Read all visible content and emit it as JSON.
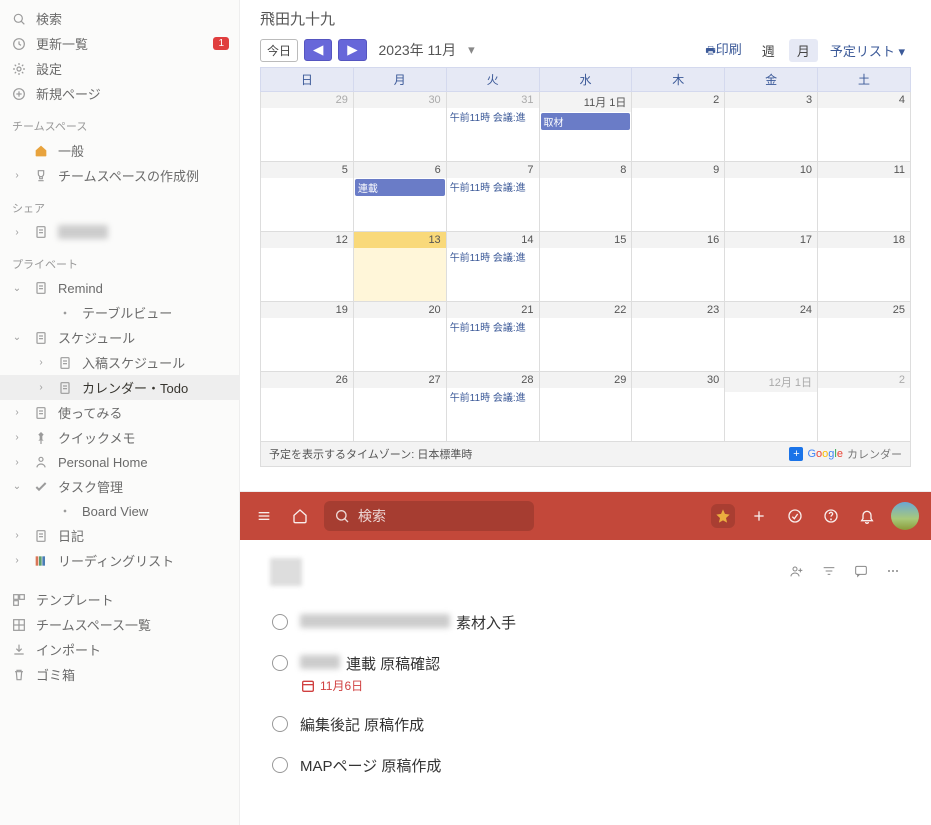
{
  "sidebar": {
    "top": [
      {
        "icon": "search",
        "label": "検索"
      },
      {
        "icon": "clock",
        "label": "更新一覧",
        "badge": "1"
      },
      {
        "icon": "gear",
        "label": "設定"
      },
      {
        "icon": "plus-circle",
        "label": "新規ページ"
      }
    ],
    "sections": [
      {
        "title": "チームスペース",
        "items": [
          {
            "chev": "",
            "icon": "home",
            "label": "一般",
            "color": "#e8a33d"
          },
          {
            "chev": "›",
            "icon": "trophy",
            "label": "チームスペースの作成例"
          }
        ]
      },
      {
        "title": "シェア",
        "items": [
          {
            "chev": "›",
            "icon": "page",
            "label": "",
            "blurred": true
          }
        ]
      },
      {
        "title": "プライベート",
        "items": [
          {
            "chev": "⌄",
            "icon": "page",
            "label": "Remind"
          },
          {
            "chev": "",
            "icon": "dot",
            "label": "テーブルビュー",
            "indent": true
          },
          {
            "chev": "⌄",
            "icon": "page",
            "label": "スケジュール"
          },
          {
            "chev": "›",
            "icon": "page",
            "label": "入稿スケジュール",
            "indent": true
          },
          {
            "chev": "›",
            "icon": "page",
            "label": "カレンダー・Todo",
            "indent": true,
            "active": true
          },
          {
            "chev": "›",
            "icon": "page",
            "label": "使ってみる"
          },
          {
            "chev": "›",
            "icon": "pin",
            "label": "クイックメモ"
          },
          {
            "chev": "›",
            "icon": "person",
            "label": "Personal Home"
          },
          {
            "chev": "⌄",
            "icon": "check",
            "label": "タスク管理"
          },
          {
            "chev": "",
            "icon": "dot",
            "label": "Board View",
            "indent": true
          },
          {
            "chev": "›",
            "icon": "page",
            "label": "日記"
          },
          {
            "chev": "›",
            "icon": "books",
            "label": "リーディングリスト"
          }
        ]
      }
    ],
    "bottom": [
      {
        "icon": "template",
        "label": "テンプレート"
      },
      {
        "icon": "grid",
        "label": "チームスペース一覧"
      },
      {
        "icon": "download",
        "label": "インポート"
      },
      {
        "icon": "trash",
        "label": "ゴミ箱"
      }
    ]
  },
  "calendar": {
    "owner": "飛田九十九",
    "todayBtn": "今日",
    "month": "2023年 11月",
    "print": "印刷",
    "views": {
      "week": "週",
      "month": "月",
      "agenda": "予定リスト"
    },
    "weekdays": [
      "日",
      "月",
      "火",
      "水",
      "木",
      "金",
      "土"
    ],
    "weeks": [
      [
        {
          "n": "29",
          "out": true
        },
        {
          "n": "30",
          "out": true
        },
        {
          "n": "31",
          "out": true,
          "events": [
            {
              "t": "午前11時 会議:進"
            }
          ]
        },
        {
          "n": "11月 1日",
          "events": [
            {
              "t": "取材",
              "blue": true
            }
          ]
        },
        {
          "n": "2"
        },
        {
          "n": "3"
        },
        {
          "n": "4"
        }
      ],
      [
        {
          "n": "5"
        },
        {
          "n": "6",
          "events": [
            {
              "t": "連載",
              "blue": true
            }
          ]
        },
        {
          "n": "7",
          "events": [
            {
              "t": "午前11時 会議:進"
            }
          ]
        },
        {
          "n": "8"
        },
        {
          "n": "9"
        },
        {
          "n": "10"
        },
        {
          "n": "11"
        }
      ],
      [
        {
          "n": "12"
        },
        {
          "n": "13",
          "today": true
        },
        {
          "n": "14",
          "events": [
            {
              "t": "午前11時 会議:進"
            }
          ]
        },
        {
          "n": "15"
        },
        {
          "n": "16"
        },
        {
          "n": "17"
        },
        {
          "n": "18"
        }
      ],
      [
        {
          "n": "19"
        },
        {
          "n": "20"
        },
        {
          "n": "21",
          "events": [
            {
              "t": "午前11時 会議:進"
            }
          ]
        },
        {
          "n": "22"
        },
        {
          "n": "23"
        },
        {
          "n": "24"
        },
        {
          "n": "25"
        }
      ],
      [
        {
          "n": "26"
        },
        {
          "n": "27"
        },
        {
          "n": "28",
          "events": [
            {
              "t": "午前11時 会議:進"
            }
          ]
        },
        {
          "n": "29"
        },
        {
          "n": "30"
        },
        {
          "n": "12月 1日",
          "out": true
        },
        {
          "n": "2",
          "out": true
        }
      ]
    ],
    "tz": "予定を表示するタイムゾーン: 日本標準時",
    "gcalLabel": "カレンダー"
  },
  "todo": {
    "searchPlaceholder": "検索",
    "tasks": [
      {
        "text": "素材入手",
        "prefixBlur": true
      },
      {
        "text": "連載 原稿確認",
        "prefixBlur": true,
        "date": "11月6日"
      },
      {
        "text": "編集後記 原稿作成"
      },
      {
        "text": "MAPページ 原稿作成"
      }
    ]
  }
}
